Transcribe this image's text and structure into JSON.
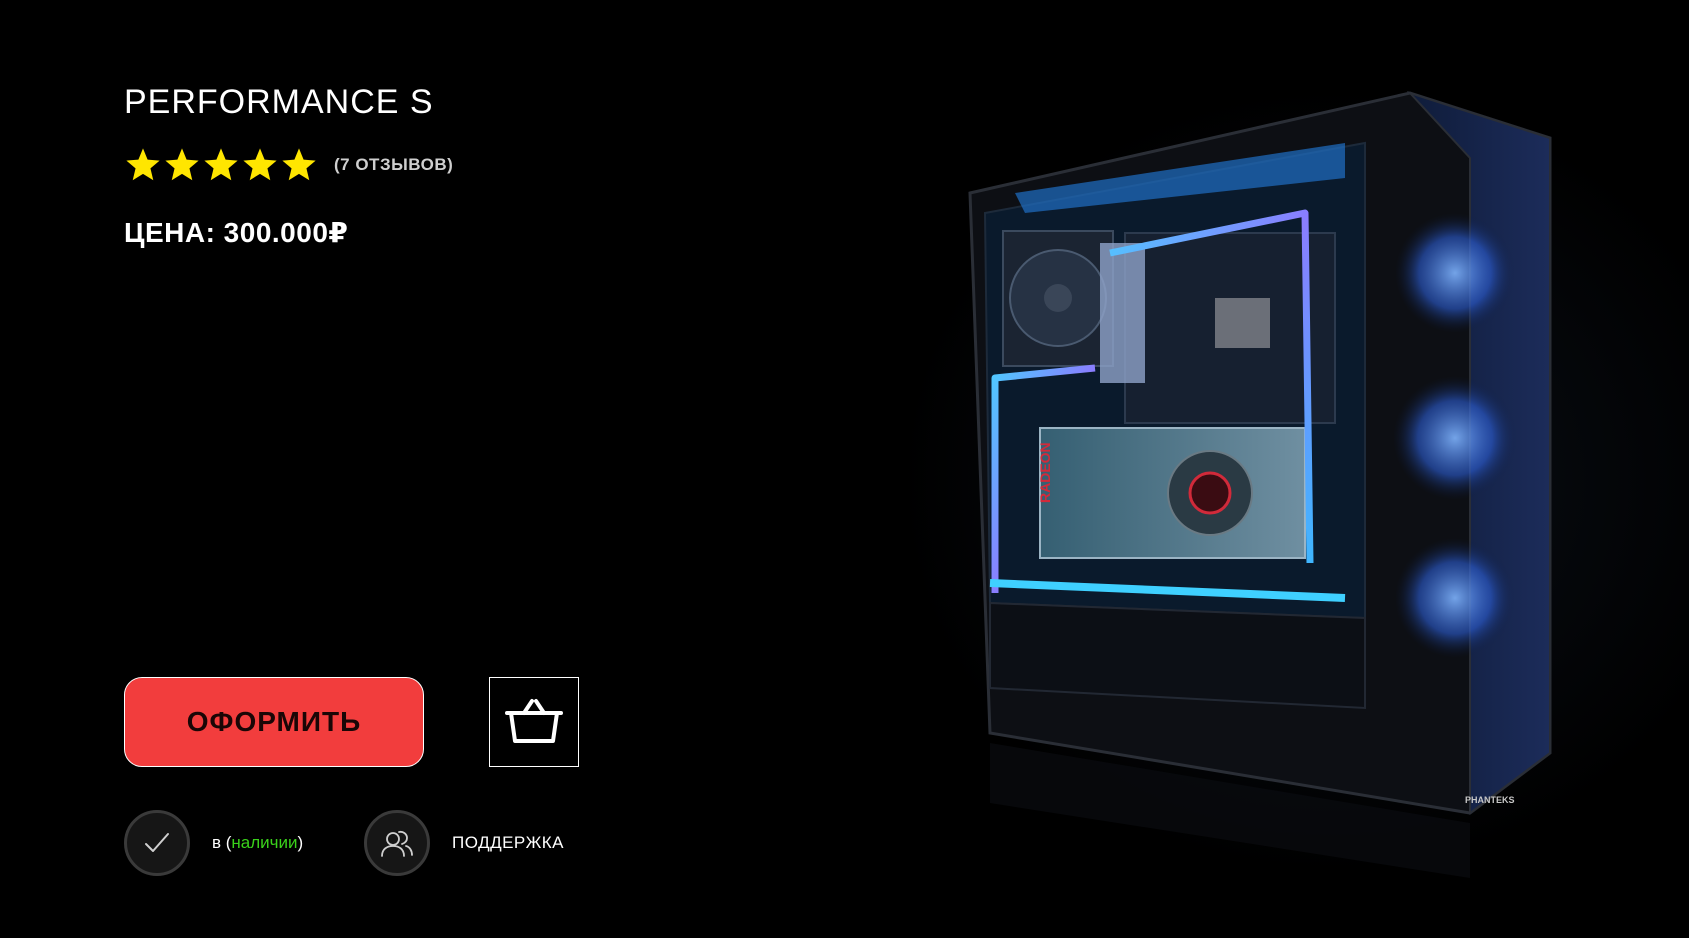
{
  "product": {
    "title": "PERFORMANCE S",
    "rating": 5,
    "rating_max": 5,
    "reviews_label": "(7 ОТЗЫВОВ)",
    "price_label": "ЦЕНА: 300.000₽",
    "image_label": "RADEON",
    "case_brand": "PHANTEKS"
  },
  "actions": {
    "order_label": "ОФОРМИТЬ",
    "cart_icon": "basket-icon"
  },
  "features": {
    "availability": {
      "icon": "checkmark-icon",
      "prefix": "в (",
      "word": "наличии",
      "suffix": ")"
    },
    "support": {
      "icon": "users-icon",
      "label": "ПОДДЕРЖКА"
    }
  },
  "colors": {
    "background": "#000000",
    "accent_red": "#f23d3d",
    "star_yellow": "#ffe600",
    "availability_green": "#3ad11a",
    "neon_blue": "#3fb6ff",
    "neon_purple": "#a36bff"
  }
}
